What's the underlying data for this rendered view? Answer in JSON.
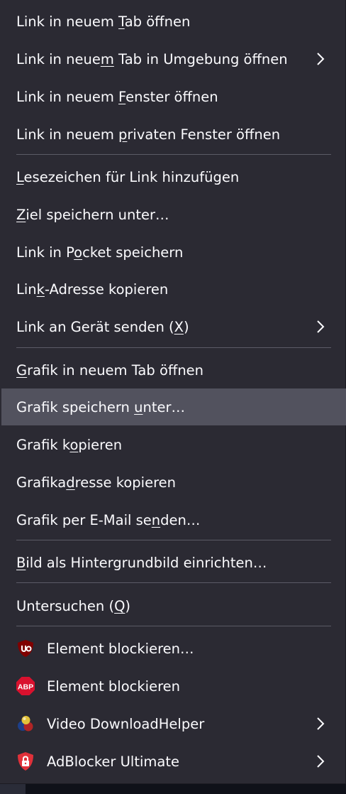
{
  "menu": {
    "items": [
      {
        "pre": "Link in neuem ",
        "acc": "T",
        "post": "ab öffnen",
        "submenu": false
      },
      {
        "pre": "Link in neue",
        "acc": "m",
        "post": " Tab in Umgebung öffnen",
        "submenu": true
      },
      {
        "pre": "Link in neuem ",
        "acc": "F",
        "post": "enster öffnen",
        "submenu": false
      },
      {
        "pre": "Link in neuem ",
        "acc": "p",
        "post": "rivaten Fenster öffnen",
        "submenu": false
      },
      {
        "pre": "",
        "acc": "L",
        "post": "esezeichen für Link hinzufügen",
        "submenu": false
      },
      {
        "pre": "",
        "acc": "Z",
        "post": "iel speichern unter…",
        "submenu": false
      },
      {
        "pre": "Link in P",
        "acc": "o",
        "post": "cket speichern",
        "submenu": false
      },
      {
        "pre": "Lin",
        "acc": "k",
        "post": "-Adresse kopieren",
        "submenu": false
      },
      {
        "pre": "Link an Gerät senden (",
        "acc": "X",
        "post": ")",
        "submenu": true
      },
      {
        "pre": "",
        "acc": "G",
        "post": "rafik in neuem Tab öffnen",
        "submenu": false
      },
      {
        "pre": "Grafik speichern ",
        "acc": "u",
        "post": "nter…",
        "submenu": false,
        "hovered": true
      },
      {
        "pre": "Grafik k",
        "acc": "o",
        "post": "pieren",
        "submenu": false
      },
      {
        "pre": "Grafika",
        "acc": "d",
        "post": "resse kopieren",
        "submenu": false
      },
      {
        "pre": "Grafik per E-Mail se",
        "acc": "n",
        "post": "den…",
        "submenu": false
      },
      {
        "pre": "",
        "acc": "B",
        "post": "ild als Hintergrundbild einrichten…",
        "submenu": false
      },
      {
        "pre": "Untersuchen (",
        "acc": "Q",
        "post": ")",
        "submenu": false
      }
    ],
    "extensions": [
      {
        "label": "Element blockieren…",
        "icon": "ublock-origin-icon",
        "submenu": false
      },
      {
        "label": "Element blockieren",
        "icon": "adblock-plus-icon",
        "icon_text": "ABP",
        "submenu": false
      },
      {
        "label": "Video DownloadHelper",
        "icon": "video-downloadhelper-icon",
        "submenu": true
      },
      {
        "label": "AdBlocker Ultimate",
        "icon": "adblocker-ultimate-icon",
        "submenu": true
      }
    ]
  },
  "colors": {
    "menu_bg": "#2b2a33",
    "hover_bg": "#52525e",
    "text": "#fbfbfe",
    "separator": "#5b5b66",
    "ublock_red": "#800000",
    "abp_red": "#d9112e",
    "adblocker_red": "#e0313a"
  }
}
